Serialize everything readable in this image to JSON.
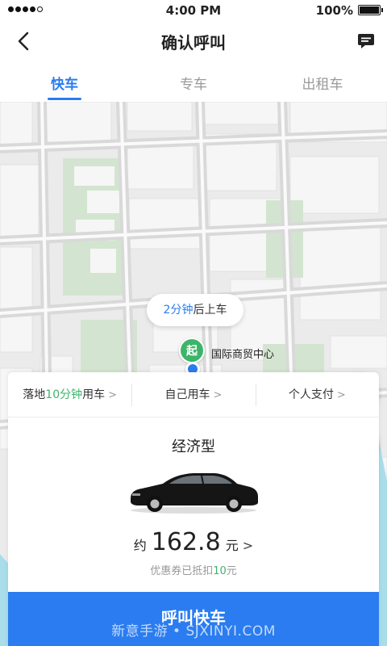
{
  "status_bar": {
    "time": "4:00 PM",
    "battery": "100%"
  },
  "header": {
    "title": "确认呼叫"
  },
  "tabs": [
    {
      "label": "快车",
      "active": true
    },
    {
      "label": "专车",
      "active": false
    },
    {
      "label": "出租车",
      "active": false
    }
  ],
  "map": {
    "eta_num": "2分钟",
    "eta_suffix": "后上车",
    "pin_label": "起",
    "place": "国际商贸中心"
  },
  "options": {
    "schedule_prefix": "落地",
    "schedule_highlight": "10分钟",
    "schedule_suffix": "用车",
    "rider": "自己用车",
    "payment": "个人支付"
  },
  "ride": {
    "car_type": "经济型",
    "price_prefix": "约",
    "price_value": "162.8",
    "price_unit": "元",
    "coupon_prefix": "优惠券已抵扣",
    "coupon_amount": "10",
    "coupon_suffix": "元"
  },
  "call_button": "呼叫快车",
  "watermark": "新意手游 • SJXINYI.COM",
  "colors": {
    "accent": "#2a7cf0",
    "green": "#3cb56a"
  }
}
